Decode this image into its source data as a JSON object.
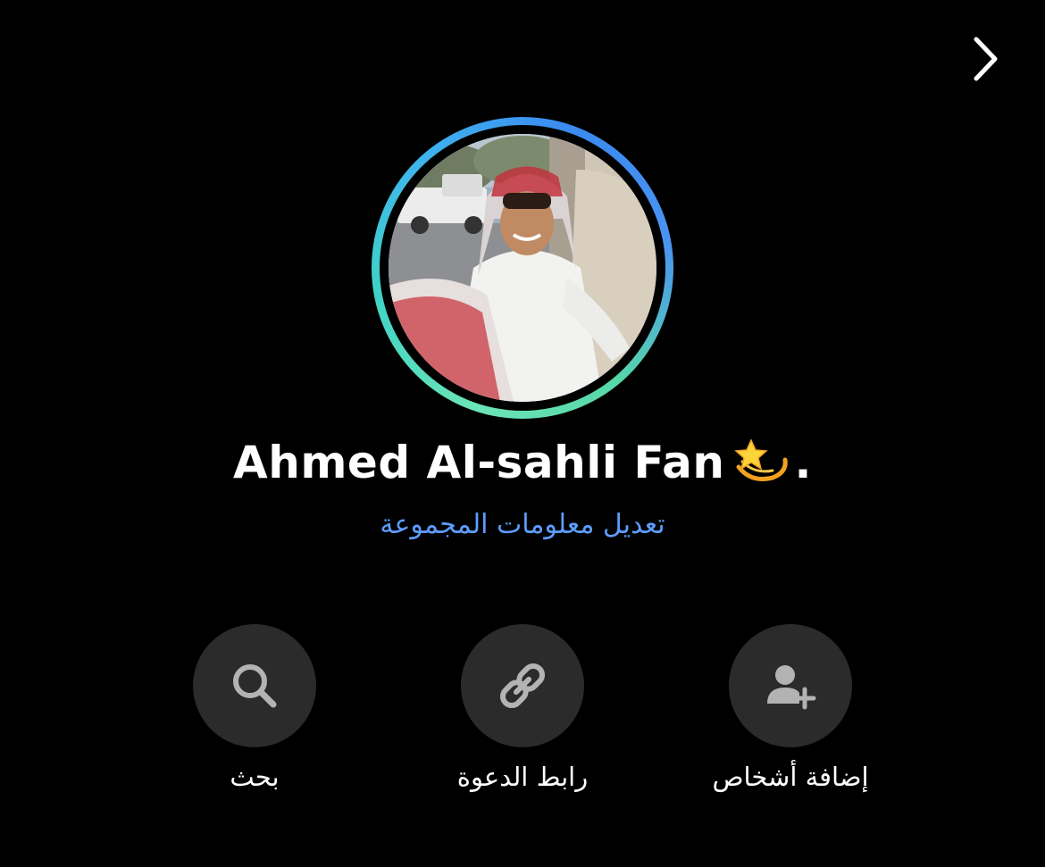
{
  "header": {
    "back_icon": "chevron-right-icon"
  },
  "group": {
    "name": "Ahmed Al-sahli Fan",
    "name_suffix": ".",
    "emoji": "dizzy-star-emoji",
    "edit_info_label": "تعديل معلومات المجموعة",
    "ring_colors": [
      "#6be4b8",
      "#3fb2ee",
      "#3a8af0"
    ],
    "link_color": "#5e9cff"
  },
  "actions": [
    {
      "label": "بحث",
      "icon": "search-icon"
    },
    {
      "label": "رابط الدعوة",
      "icon": "link-icon"
    },
    {
      "label": "إضافة أشخاص",
      "icon": "add-person-icon"
    }
  ]
}
